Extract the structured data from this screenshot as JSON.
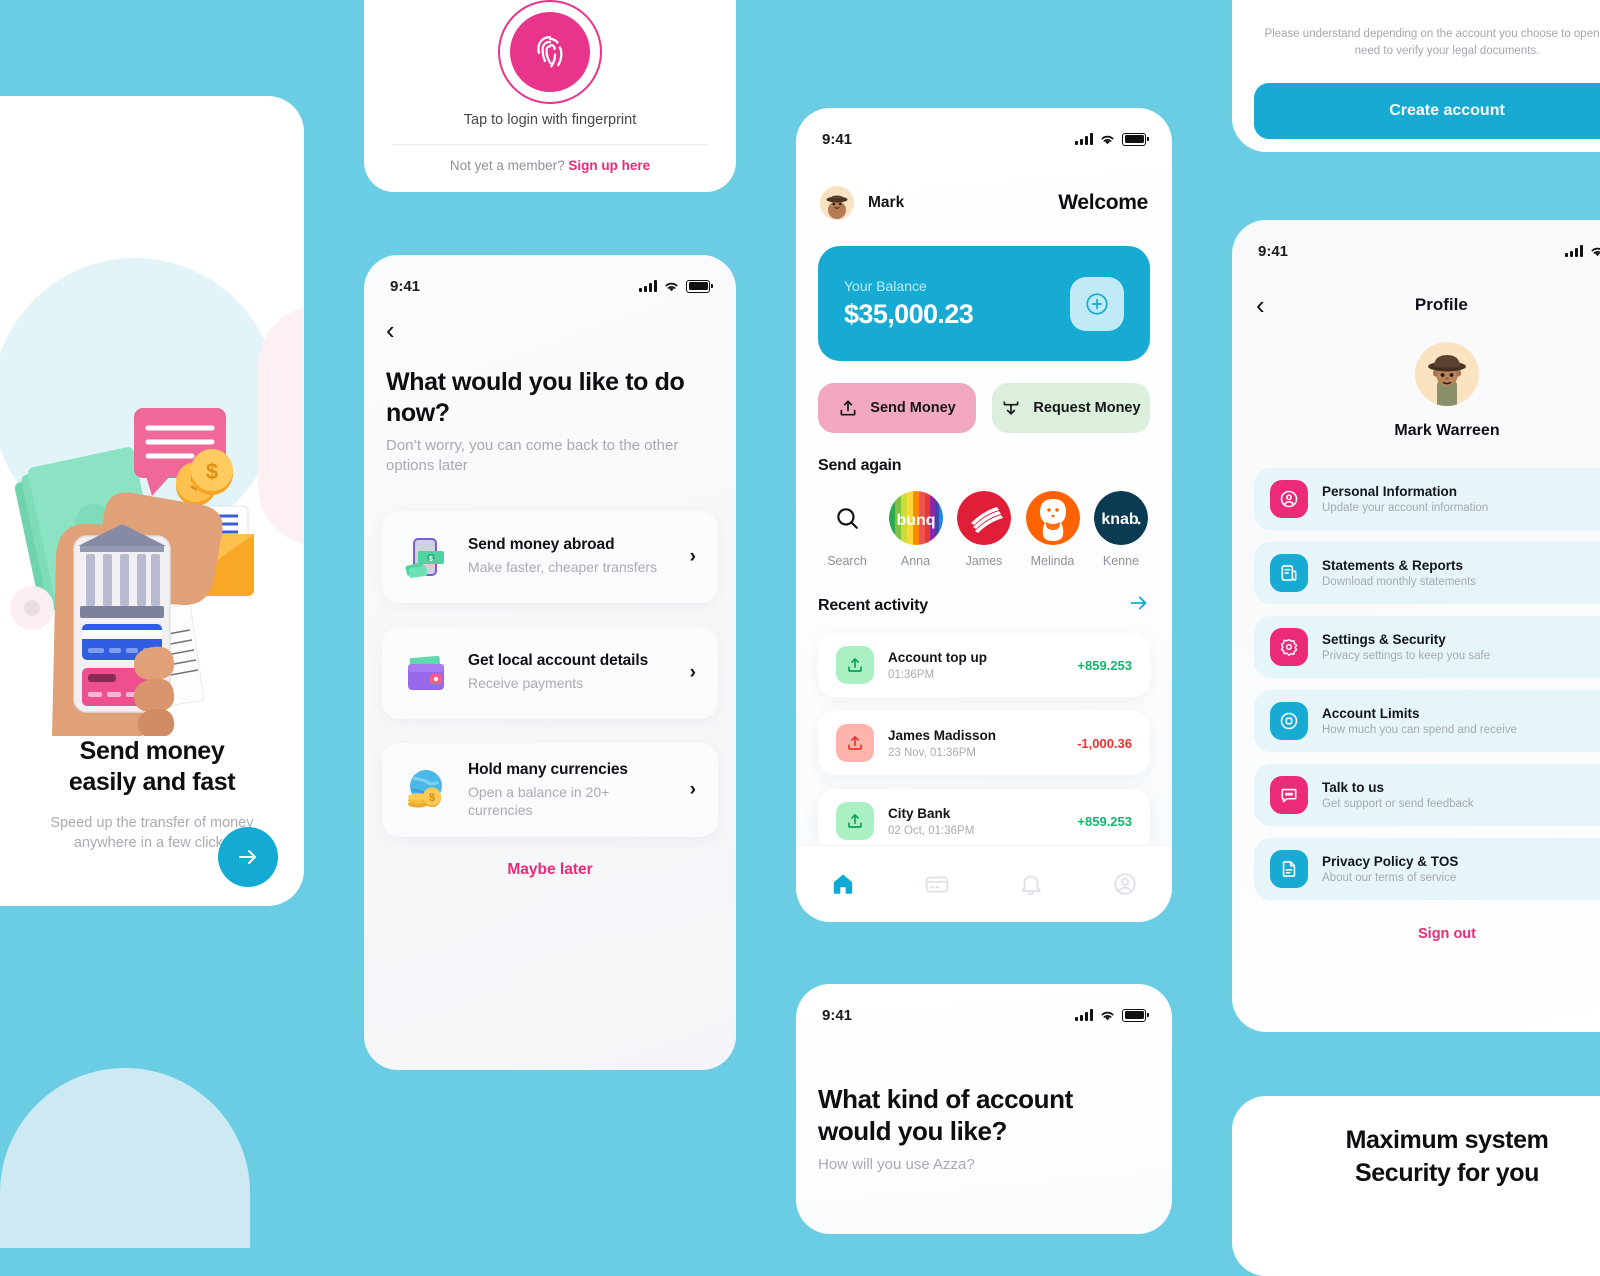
{
  "theme": {
    "background": "#6ACDE4",
    "accent_blue": "#17ABD3",
    "accent_pink": "#EC2A77",
    "positive": "#12B76A",
    "negative": "#F0322C"
  },
  "onboarding": {
    "title_line1": "Send money",
    "title_line2": "easily and fast",
    "subtitle_line1": "Speed up the transfer of money",
    "subtitle_line2": "anywhere in a few clicks",
    "next_icon": "arrow-right-icon"
  },
  "fingerprint": {
    "icon": "fingerprint-icon",
    "label": "Tap to login with fingerprint",
    "footer_prefix": "Not yet a member? ",
    "footer_link": "Sign up here"
  },
  "options": {
    "status_time": "9:41",
    "back_icon": "chevron-left-icon",
    "title": "What would you like to do now?",
    "subtitle": "Don’t worry, you can come back to the other options later",
    "items": [
      {
        "title": "Send money abroad",
        "desc": "Make faster, cheaper transfers",
        "icon": "banknote-phone-icon"
      },
      {
        "title": "Get local account details",
        "desc": "Receive payments",
        "icon": "wallet-icon"
      },
      {
        "title": "Hold many currencies",
        "desc": "Open a balance in 20+ currencies",
        "icon": "globe-coins-icon"
      }
    ],
    "maybe_later": "Maybe later"
  },
  "home": {
    "status_time": "9:41",
    "user_name": "Mark",
    "welcome": "Welcome",
    "balance_label": "Your Balance",
    "balance_amount": "$35,000.23",
    "add_icon": "plus-circle-icon",
    "actions": [
      {
        "label": "Send Money",
        "icon": "upload-icon",
        "color": "#F2A8C0"
      },
      {
        "label": "Request Money",
        "icon": "download-icon",
        "color": "#DCEEDC"
      }
    ],
    "send_again_title": "Send again",
    "contacts": [
      {
        "name": "Search",
        "logo": "search-icon"
      },
      {
        "name": "Anna",
        "logo": "bunq-logo"
      },
      {
        "name": "James",
        "logo": "bank-of-america-logo"
      },
      {
        "name": "Melinda",
        "logo": "ing-lion-logo"
      },
      {
        "name": "Kenne",
        "logo": "knab-logo"
      }
    ],
    "recent_title": "Recent activity",
    "recent_see_all_icon": "arrow-right-icon",
    "transactions": [
      {
        "title": "Account top up",
        "time": "01:36PM",
        "amount": "+859.253",
        "direction": "in"
      },
      {
        "title": "James Madisson",
        "time": "23 Nov, 01:36PM",
        "amount": "-1,000.36",
        "direction": "out"
      },
      {
        "title": "City Bank",
        "time": "02 Oct, 01:36PM",
        "amount": "+859.253",
        "direction": "in"
      }
    ],
    "tabs": [
      {
        "name": "home-tab",
        "icon": "home-icon",
        "active": true
      },
      {
        "name": "cards-tab",
        "icon": "card-icon",
        "active": false
      },
      {
        "name": "notifications-tab",
        "icon": "bell-icon",
        "active": false
      },
      {
        "name": "profile-tab",
        "icon": "user-circle-icon",
        "active": false
      }
    ]
  },
  "account_type": {
    "status_time": "9:41",
    "title_line1": "What kind of account",
    "title_line2": "would you like?",
    "subtitle": "How will you use Azza?"
  },
  "create_account": {
    "note": "Please understand depending on the account you choose to open, we’d need to verify your legal documents.",
    "button_label": "Create account"
  },
  "profile": {
    "status_time": "9:41",
    "back_icon": "chevron-left-icon",
    "title": "Profile",
    "name": "Mark Warreen",
    "items": [
      {
        "title": "Personal Information",
        "desc": "Update your account information",
        "icon": "user-circle-icon",
        "color": "#EC2A77"
      },
      {
        "title": "Statements & Reports",
        "desc": "Download monthly statements",
        "icon": "document-icon",
        "color": "#17ABD3"
      },
      {
        "title": "Settings & Security",
        "desc": "Privacy settings to keep you safe",
        "icon": "gear-icon",
        "color": "#EC2A77"
      },
      {
        "title": "Account Limits",
        "desc": "How much you can spend and receive",
        "icon": "target-icon",
        "color": "#17ABD3"
      },
      {
        "title": "Talk to us",
        "desc": "Get support or send feedback",
        "icon": "chat-icon",
        "color": "#EC2A77"
      },
      {
        "title": "Privacy Policy & TOS",
        "desc": "About our terms of service",
        "icon": "file-icon",
        "color": "#17ABD3"
      }
    ],
    "sign_out": "Sign out"
  },
  "security": {
    "title_line1": "Maximum system",
    "title_line2": "Security for you"
  }
}
